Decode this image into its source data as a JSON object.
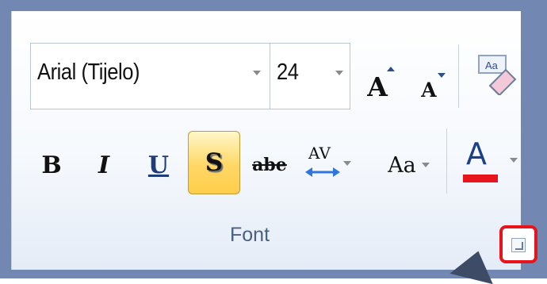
{
  "font_group": {
    "font_name": {
      "value": "Arial (Tijelo)"
    },
    "font_size": {
      "value": "24"
    },
    "buttons": {
      "grow_font": "A",
      "shrink_font": "A",
      "clear_format_icon": "clear-formatting-icon",
      "bold": "B",
      "italic": "I",
      "underline": "U",
      "shadow": "S",
      "strikethrough": "abe",
      "character_spacing": "AV",
      "change_case": "Aa",
      "font_color": "A"
    },
    "label": "Font"
  },
  "colors": {
    "ribbon_border": "#7288b3",
    "label_text": "#4a5f82",
    "highlight": "#ffd765",
    "font_color_bar": "#e8141b",
    "launcher_outline": "#e8141b"
  }
}
